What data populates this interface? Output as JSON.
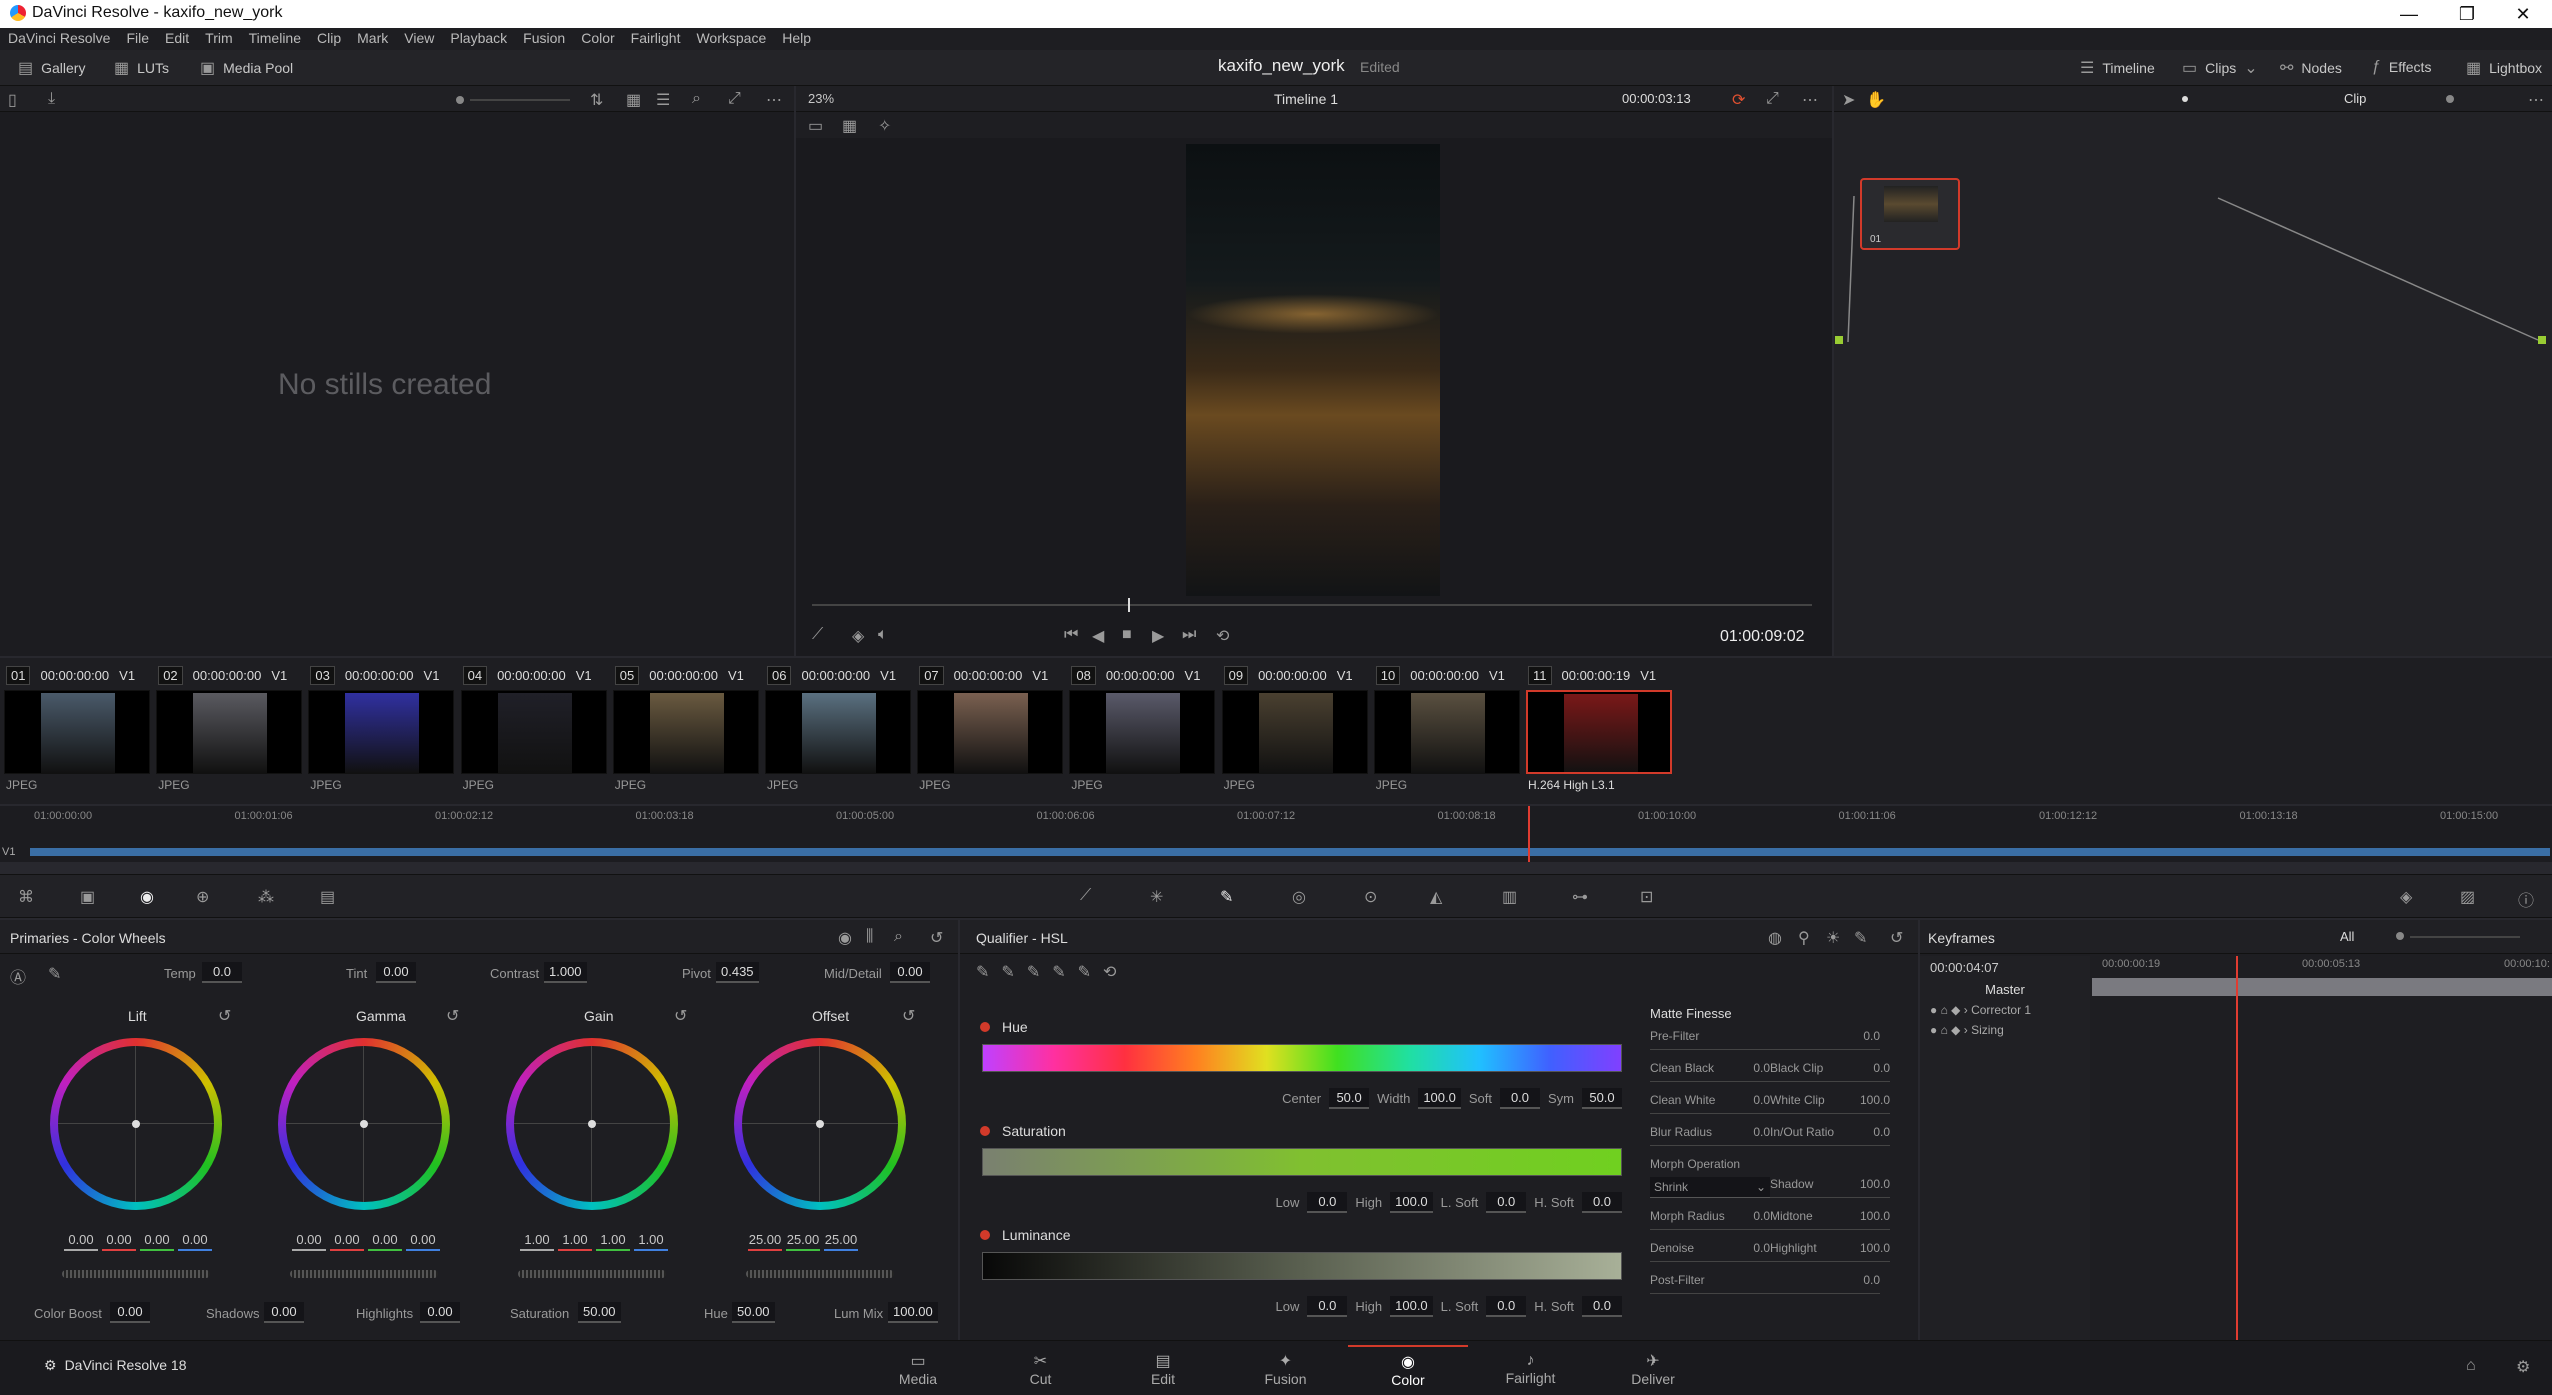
{
  "window": {
    "title": "DaVinci Resolve - kaxifo_new_york"
  },
  "menu": [
    "DaVinci Resolve",
    "File",
    "Edit",
    "Trim",
    "Timeline",
    "Clip",
    "Mark",
    "View",
    "Playback",
    "Fusion",
    "Color",
    "Fairlight",
    "Workspace",
    "Help"
  ],
  "toolbar": {
    "gallery": "Gallery",
    "luts": "LUTs",
    "media_pool": "Media Pool",
    "project": "kaxifo_new_york",
    "status": "Edited",
    "timeline": "Timeline",
    "clips": "Clips",
    "nodes": "Nodes",
    "effects": "Effects",
    "lightbox": "Lightbox"
  },
  "viewer": {
    "zoom": "23%",
    "timeline_name": "Timeline 1",
    "source_tc": "00:00:03:13",
    "timecode": "01:00:09:02",
    "clip_mode": "Clip"
  },
  "gallery": {
    "empty": "No stills created"
  },
  "node": {
    "label": "01"
  },
  "clips": [
    {
      "num": "01",
      "tc": "00:00:00:00",
      "track": "V1",
      "fmt": "JPEG"
    },
    {
      "num": "02",
      "tc": "00:00:00:00",
      "track": "V1",
      "fmt": "JPEG"
    },
    {
      "num": "03",
      "tc": "00:00:00:00",
      "track": "V1",
      "fmt": "JPEG"
    },
    {
      "num": "04",
      "tc": "00:00:00:00",
      "track": "V1",
      "fmt": "JPEG"
    },
    {
      "num": "05",
      "tc": "00:00:00:00",
      "track": "V1",
      "fmt": "JPEG"
    },
    {
      "num": "06",
      "tc": "00:00:00:00",
      "track": "V1",
      "fmt": "JPEG"
    },
    {
      "num": "07",
      "tc": "00:00:00:00",
      "track": "V1",
      "fmt": "JPEG"
    },
    {
      "num": "08",
      "tc": "00:00:00:00",
      "track": "V1",
      "fmt": "JPEG"
    },
    {
      "num": "09",
      "tc": "00:00:00:00",
      "track": "V1",
      "fmt": "JPEG"
    },
    {
      "num": "10",
      "tc": "00:00:00:00",
      "track": "V1",
      "fmt": "JPEG"
    },
    {
      "num": "11",
      "tc": "00:00:00:19",
      "track": "V1",
      "fmt": "H.264 High L3.1"
    }
  ],
  "ruler": [
    "01:00:00:00",
    "01:00:01:06",
    "01:00:02:12",
    "01:00:03:18",
    "01:00:05:00",
    "01:00:06:06",
    "01:00:07:12",
    "01:00:08:18",
    "01:00:10:00",
    "01:00:11:06",
    "01:00:12:12",
    "01:00:13:18",
    "01:00:15:00"
  ],
  "track_label": "V1",
  "primaries": {
    "title": "Primaries - Color Wheels",
    "temp_label": "Temp",
    "temp": "0.0",
    "tint_label": "Tint",
    "tint": "0.00",
    "contrast_label": "Contrast",
    "contrast": "1.000",
    "pivot_label": "Pivot",
    "pivot": "0.435",
    "middetail_label": "Mid/Detail",
    "middetail": "0.00",
    "wheels": [
      {
        "name": "Lift",
        "values": [
          "0.00",
          "0.00",
          "0.00",
          "0.00"
        ]
      },
      {
        "name": "Gamma",
        "values": [
          "0.00",
          "0.00",
          "0.00",
          "0.00"
        ]
      },
      {
        "name": "Gain",
        "values": [
          "1.00",
          "1.00",
          "1.00",
          "1.00"
        ]
      },
      {
        "name": "Offset",
        "values": [
          "25.00",
          "25.00",
          "25.00"
        ]
      }
    ],
    "colorboost_label": "Color Boost",
    "colorboost": "0.00",
    "shadows_label": "Shadows",
    "shadows": "0.00",
    "highlights_label": "Highlights",
    "highlights": "0.00",
    "saturation_label": "Saturation",
    "saturation": "50.00",
    "hue_label": "Hue",
    "hue": "50.00",
    "lummix_label": "Lum Mix",
    "lummix": "100.00"
  },
  "qualifier": {
    "title": "Qualifier - HSL",
    "hue": {
      "label": "Hue",
      "center_l": "Center",
      "center": "50.0",
      "width_l": "Width",
      "width": "100.0",
      "soft_l": "Soft",
      "soft": "0.0",
      "sym_l": "Sym",
      "sym": "50.0"
    },
    "sat": {
      "label": "Saturation",
      "low_l": "Low",
      "low": "0.0",
      "high_l": "High",
      "high": "100.0",
      "lsoft_l": "L. Soft",
      "lsoft": "0.0",
      "hsoft_l": "H. Soft",
      "hsoft": "0.0"
    },
    "lum": {
      "label": "Luminance",
      "low_l": "Low",
      "low": "0.0",
      "high_l": "High",
      "high": "100.0",
      "lsoft_l": "L. Soft",
      "lsoft": "0.0",
      "hsoft_l": "H. Soft",
      "hsoft": "0.0"
    }
  },
  "matte": {
    "title": "Matte Finesse",
    "prefilter_l": "Pre-Filter",
    "prefilter": "0.0",
    "cleanblack_l": "Clean Black",
    "cleanblack": "0.0",
    "blackclip_l": "Black Clip",
    "blackclip": "0.0",
    "cleanwhite_l": "Clean White",
    "cleanwhite": "0.0",
    "whiteclip_l": "White Clip",
    "whiteclip": "100.0",
    "blurradius_l": "Blur Radius",
    "blurradius": "0.0",
    "inout_l": "In/Out Ratio",
    "inout": "0.0",
    "morph_l": "Morph Operation",
    "morph": "Shrink",
    "shadow_l": "Shadow",
    "shadow": "100.0",
    "morphradius_l": "Morph Radius",
    "morphradius": "0.0",
    "midtone_l": "Midtone",
    "midtone": "100.0",
    "denoise_l": "Denoise",
    "denoise": "0.0",
    "highlight_l": "Highlight",
    "highlight": "100.0",
    "postfilter_l": "Post-Filter",
    "postfilter": "0.0"
  },
  "keyframes": {
    "title": "Keyframes",
    "filter": "All",
    "tc": "00:00:04:07",
    "t1": "00:00:00:19",
    "t2": "00:00:05:13",
    "t3": "00:00:10:",
    "master": "Master",
    "corrector": "Corrector 1",
    "sizing": "Sizing"
  },
  "pages": [
    "Media",
    "Cut",
    "Edit",
    "Fusion",
    "Color",
    "Fairlight",
    "Deliver"
  ],
  "active_page": "Color",
  "brand": "DaVinci Resolve 18",
  "colors": {
    "accent": "#d23a2a",
    "playhead": "#e03c31",
    "track": "#3a6ea5"
  }
}
